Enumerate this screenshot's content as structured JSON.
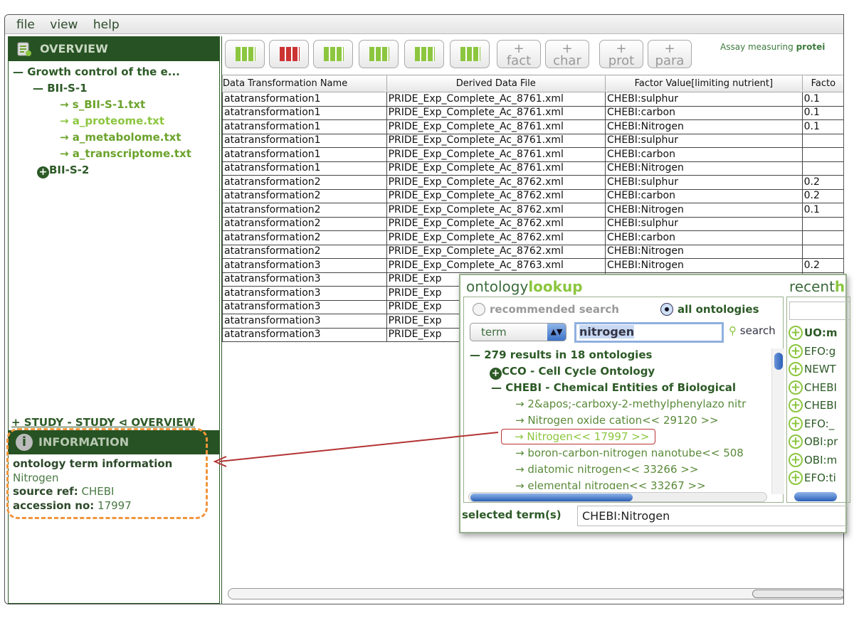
{
  "menu": [
    "file",
    "view",
    "help"
  ],
  "overview": {
    "title": "OVERVIEW",
    "icon": "overview-clipboard-icon"
  },
  "tree": {
    "root": "— Growth control of the e...",
    "study1": "— BII-S-1",
    "files": [
      "→ s_BII-S-1.txt",
      "→ a_proteome.txt",
      "→ a_metabolome.txt",
      "→ a_transcriptome.txt"
    ],
    "study2": "BII-S-2"
  },
  "study_bar": "+ STUDY - STUDY ⊲ OVERVIEW",
  "information": {
    "title": "INFORMATION",
    "heading": "ontology term information",
    "term": "Nitrogen",
    "source_label": "source ref:",
    "source": "CHEBI",
    "accession_label": "accession no:",
    "accession": "17997"
  },
  "toolbar": {
    "text_buttons": [
      {
        "plus": "+",
        "label": "fact"
      },
      {
        "plus": "+",
        "label": "char"
      },
      {
        "plus": "+",
        "label": "prot"
      },
      {
        "plus": "+",
        "label": "para"
      }
    ],
    "assay_prefix": "Assay measuring ",
    "assay_bold": "protei"
  },
  "table": {
    "columns": [
      "Data Transformation Name",
      "Derived Data File",
      "Factor Value[limiting nutrient]",
      "Facto"
    ],
    "rows": [
      [
        "atatransformation1",
        "PRIDE_Exp_Complete_Ac_8761.xml",
        "CHEBI:sulphur",
        "0.1"
      ],
      [
        "atatransformation1",
        "PRIDE_Exp_Complete_Ac_8761.xml",
        "CHEBI:carbon",
        "0.1"
      ],
      [
        "atatransformation1",
        "PRIDE_Exp_Complete_Ac_8761.xml",
        "CHEBI:Nitrogen",
        "0.1"
      ],
      [
        "atatransformation1",
        "PRIDE_Exp_Complete_Ac_8761.xml",
        "CHEBI:sulphur",
        ""
      ],
      [
        "atatransformation1",
        "PRIDE_Exp_Complete_Ac_8761.xml",
        "CHEBI:carbon",
        ""
      ],
      [
        "atatransformation1",
        "PRIDE_Exp_Complete_Ac_8761.xml",
        "CHEBI:Nitrogen",
        ""
      ],
      [
        "atatransformation2",
        "PRIDE_Exp_Complete_Ac_8762.xml",
        "CHEBI:sulphur",
        "0.2"
      ],
      [
        "atatransformation2",
        "PRIDE_Exp_Complete_Ac_8762.xml",
        "CHEBI:carbon",
        "0.2"
      ],
      [
        "atatransformation2",
        "PRIDE_Exp_Complete_Ac_8762.xml",
        "CHEBI:Nitrogen",
        "0.1"
      ],
      [
        "atatransformation2",
        "PRIDE_Exp_Complete_Ac_8762.xml",
        "CHEBI:sulphur",
        ""
      ],
      [
        "atatransformation2",
        "PRIDE_Exp_Complete_Ac_8762.xml",
        "CHEBI:carbon",
        ""
      ],
      [
        "atatransformation2",
        "PRIDE_Exp_Complete_Ac_8762.xml",
        "CHEBI:Nitrogen",
        ""
      ],
      [
        "atatransformation3",
        "PRIDE_Exp_Complete_Ac_8763.xml",
        "CHEBI:Nitrogen",
        "0.2"
      ],
      [
        "atatransformation3",
        "PRIDE_Exp",
        "",
        ""
      ],
      [
        "atatransformation3",
        "PRIDE_Exp",
        "",
        ""
      ],
      [
        "atatransformation3",
        "PRIDE_Exp",
        "",
        ""
      ],
      [
        "atatransformation3",
        "PRIDE_Exp",
        "",
        ""
      ],
      [
        "atatransformation3",
        "PRIDE_Exp",
        "",
        ""
      ]
    ]
  },
  "ontology": {
    "title_a": "ontology",
    "title_b": "lookup",
    "recent_a": "recent",
    "recent_b": "h",
    "radio_recommended": "recommended search",
    "radio_all": "all ontologies",
    "selected_radio": "all ontologies",
    "search_type": "term",
    "search_value": "nitrogen",
    "search_button": "search",
    "results_summary": "— 279 results in 18 ontologies",
    "groups": [
      {
        "label": "CCO - Cell Cycle Ontology",
        "expanded": false
      },
      {
        "label": "— CHEBI - Chemical Entities of Biological",
        "expanded": true
      }
    ],
    "terms": [
      "→ 2&apos;-carboxy-2-methylphenylazo nitr",
      "→ Nitrogen oxide cation<< 29120 >>",
      "→ Nitrogen<< 17997 >>",
      "→ boron-carbon-nitrogen nanotube<< 508",
      "→ diatomic nitrogen<< 33266 >>",
      "→ elemental nitrogen<< 33267 >>"
    ],
    "highlighted_term": "→ Nitrogen<< 17997 >>",
    "recent": [
      "UO:m",
      "EFO:g",
      "NEWT",
      "CHEBI",
      "CHEBI",
      "EFO:_",
      "OBI:pr",
      "OBI:m",
      "EFO:ti"
    ],
    "selected_label": "selected term(s)",
    "selected_value": "CHEBI:Nitrogen"
  },
  "colors": {
    "header_green": "#275223",
    "accent_lime": "#8cc63f",
    "annotation_orange": "#f0953c",
    "annotation_red": "#b33333"
  }
}
